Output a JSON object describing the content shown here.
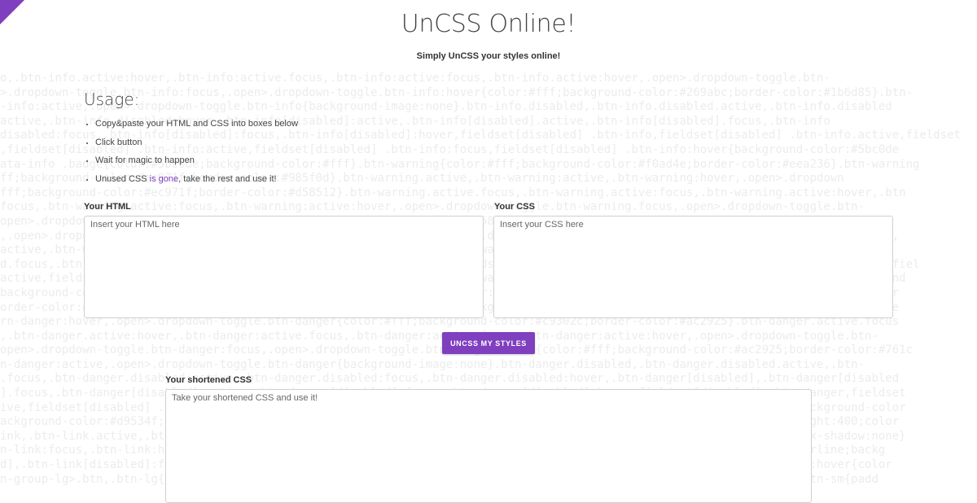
{
  "header": {
    "title": "UnCSS Online!",
    "subtitle": "Simply UnCSS your styles online!"
  },
  "usage": {
    "heading": "Usage:",
    "steps": [
      "Copy&paste your HTML and CSS into boxes below",
      "Click button",
      "Wait for magic to happen"
    ],
    "last_step": {
      "before": "Unused CSS ",
      "link": "is gone",
      "after": ", take the rest and use it!"
    }
  },
  "html_input": {
    "label": "Your HTML",
    "placeholder": "Insert your HTML here"
  },
  "css_input": {
    "label": "Your CSS",
    "placeholder": "Insert your CSS here"
  },
  "action": {
    "button_label": "UNCSS MY STYLES"
  },
  "output": {
    "label": "Your shortened CSS",
    "placeholder": "Take your shortened CSS and use it!"
  },
  "background_code": [
    "o,.btn-info.active:hover,.btn-info:active.focus,.btn-info:active:focus,.btn-info.active:hover,.open>.dropdown-toggle.btn-",
    ">.dropdown-toggle.btn-info:focus,.open>.dropdown-toggle.btn-info:hover{color:#fff;background-color:#269abc;border-color:#1b6d85}.btn-",
    "-info:active,.open>.dropdown-toggle.btn-info{background-image:none}.btn-info.disabled,.btn-info.disabled.active,.btn-info.disabled",
    "active,.btn-info.disabled:hover,.btn-info[disabled]:active,.btn-info[disabled].active,.btn-info[disabled].focus,.btn-info",
    "disabled:focus,.btn-info[disabled]:focus,.btn-info[disabled]:hover,fieldset[disabled] .btn-info,fieldset[disabled] .btn-info.active,fieldset",
    ",fieldset[disabled] .btn-info:active,fieldset[disabled] .btn-info:focus,fieldset[disabled] .btn-info:hover{background-color:#5bc0de",
    "ata-info .badge{color:#5bc0de;background-color:#fff}.btn-warning{color:#fff;background-color:#f0ad4e;border-color:#eea236}.btn-warning",
    "ff;background-color:#ec971f;border-color:#985f0d}.btn-warning.active,.btn-warning:active,.btn-warning:hover,.open>.dropdown",
    "fff;background-color:#ec971f;border-color:#d58512}.btn-warning.active.focus,.btn-warning.active:focus,.btn-warning.active:hover,.btn",
    "focus,.btn-warning:active:focus,.btn-warning:active:hover,.open>.dropdown-toggle.btn-warning.focus,.open>.dropdown-toggle.btn-",
    "open>.dropdown-toggle.btn-warning:hover{color:#fff;background-color:#d58512;border-color:#985f0c}.btn-warning.active,.btn-",
    ",.open>.dropdown-toggle.btn-warning{background-image:none}.btn-warning.disabled,.btn-warning.disabled.active,.btn-warning.disabled,",
    "active,.btn-warning.disabled:hover,.btn-warning[disabled].active,.btn-warning[disabled].focus,.btn-warning[disabled]:active,",
    "d.focus,.btn-warning[disabled]:focus,.btn-warning[disabled]:hover,fieldset[disabled] .btn-warning,fieldset[disabled] .btn-warning,fiel",
    "active,fieldset[disabled] .btn-warning:active,fieldset[disabled] .btn-warning:focus,fieldset[disabled] .btn-warning:hover{background",
    "background-color:#f0ad4e;border-color:#eea236}.btn-warning .badge{color:#f0ad4e;background-color:#fff}.btn-danger{color:#fff;backgr",
    "order-color:#d43f3a}.btn-danger.focus,.btn-danger:focus{color:#fff;background-color:#c9302c;border-color:#761c19}.btn-danger.active",
    "rn-danger:hover,.open>.dropdown-toggle.btn-danger{color:#fff;background-color:#c9302c;border-color:#ac2925}.btn-danger.active.focus",
    ",.btn-danger.active:hover,.btn-danger:active.focus,.btn-danger:active:focus,.btn-danger:active:hover,.open>.dropdown-toggle.btn-",
    "open>.dropdown-toggle.btn-danger:focus,.open>.dropdown-toggle.btn-danger:hover{color:#fff;background-color:#ac2925;border-color:#761c",
    "n-danger:active,.open>.dropdown-toggle.btn-danger{background-image:none}.btn-danger.disabled,.btn-danger.disabled.active,.btn-",
    ".focus,.btn-danger.disabled:active,.btn-danger.disabled:focus,.btn-danger.disabled:hover,.btn-danger[disabled],.btn-danger[disabled",
    "].focus,.btn-danger[disabled]:active,.btn-danger[disabled]:focus,.btn-danger[disabled]:hover,fieldset[disabled] .btn-danger,fieldset",
    "ive,fieldset[disabled] .btn-danger:active,fieldset[disabled] .btn-danger:focus,fieldset[disabled] .btn-danger:hover{background-color",
    "ackground-color:#d9534f;border-color:#d43f3a}.btn-danger .badge{color:#d9534f;background-color:#fff}.btn-link{font-weight:400;color",
    "ink,.btn-link.active,.btn-link:active,.btn-link[disabled],fieldset[disabled] .btn-link{background-color:transparent;box-shadow:none}",
    "n-link:focus,.btn-link:hover{color:#23527c;text-decoration:underline;background-color:transparent}.btn-decoration:underline;backg",
    "d],.btn-link[disabled]:focus,.btn-link[disabled]:hover,fieldset[disabled] .btn-link:focus,fieldset[disabled] .btn-link:hover{color",
    "n-group-lg>.btn,.btn-lg{padding:10px 16px;font-size:18px;line-height:1.3333333;border-radius:6px}.btn-group-sm>.btn,.btn-sm{padd"
  ]
}
